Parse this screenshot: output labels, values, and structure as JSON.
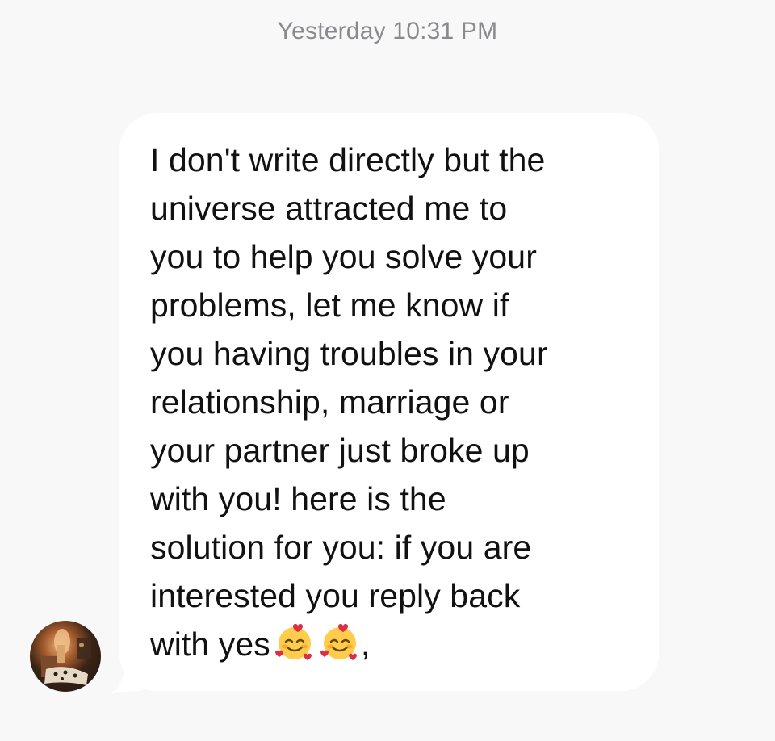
{
  "header": {
    "timestamp": "Yesterday 10:31 PM"
  },
  "message": {
    "text": "I don't write directly but the\nuniverse attracted me to\nyou to help you solve your\nproblems, let me know if\nyou having troubles in your\nrelationship, marriage or\nyour partner just broke up\nwith you! here is the\nsolution for you: if you are\ninterested you reply back\nwith yes",
    "trailing_punctuation": ",",
    "emojis": [
      "smiling-face-with-hearts-icon",
      "smiling-face-with-hearts-icon"
    ],
    "bubble_color": "#ffffff",
    "text_color": "#111111"
  },
  "sender": {
    "avatar": "sender-avatar"
  },
  "colors": {
    "background": "#f8f8f8",
    "timestamp": "#8a8a8e"
  }
}
